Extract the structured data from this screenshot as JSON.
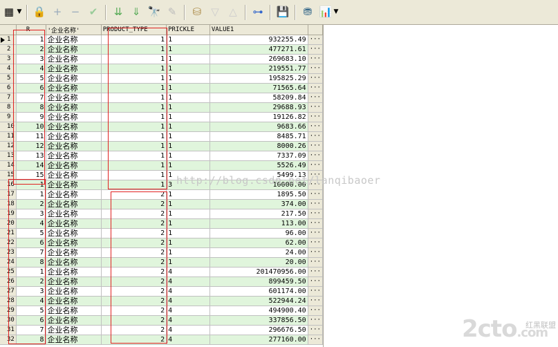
{
  "toolbar": {
    "icons": [
      "grid-icon",
      "lock-icon",
      "add-icon",
      "remove-icon",
      "post-icon",
      "filter-down-icon",
      "filter-down2-icon",
      "find-icon",
      "clear-icon",
      "query-icon",
      "sort-desc-icon",
      "sort-asc-icon",
      "tree-icon",
      "save-icon",
      "export-icon",
      "chart-icon"
    ]
  },
  "grid": {
    "columns": [
      "",
      "R",
      "'企业名称'",
      "PRODUCT_TYPE",
      "PRICKLE",
      "VALUE1",
      ""
    ],
    "ellipsis": "···",
    "rows": [
      {
        "n": "1",
        "r": "1",
        "name": "企业名称",
        "pt": "1",
        "pr": "1",
        "v": "932255.49"
      },
      {
        "n": "2",
        "r": "2",
        "name": "企业名称",
        "pt": "1",
        "pr": "1",
        "v": "477271.61"
      },
      {
        "n": "3",
        "r": "3",
        "name": "企业名称",
        "pt": "1",
        "pr": "1",
        "v": "269683.10"
      },
      {
        "n": "4",
        "r": "4",
        "name": "企业名称",
        "pt": "1",
        "pr": "1",
        "v": "219551.77"
      },
      {
        "n": "5",
        "r": "5",
        "name": "企业名称",
        "pt": "1",
        "pr": "1",
        "v": "195825.29"
      },
      {
        "n": "6",
        "r": "6",
        "name": "企业名称",
        "pt": "1",
        "pr": "1",
        "v": "71565.64"
      },
      {
        "n": "7",
        "r": "7",
        "name": "企业名称",
        "pt": "1",
        "pr": "1",
        "v": "58209.84"
      },
      {
        "n": "8",
        "r": "8",
        "name": "企业名称",
        "pt": "1",
        "pr": "1",
        "v": "29688.93"
      },
      {
        "n": "9",
        "r": "9",
        "name": "企业名称",
        "pt": "1",
        "pr": "1",
        "v": "19126.82"
      },
      {
        "n": "10",
        "r": "10",
        "name": "企业名称",
        "pt": "1",
        "pr": "1",
        "v": "9683.66"
      },
      {
        "n": "11",
        "r": "11",
        "name": "企业名称",
        "pt": "1",
        "pr": "1",
        "v": "8485.71"
      },
      {
        "n": "12",
        "r": "12",
        "name": "企业名称",
        "pt": "1",
        "pr": "1",
        "v": "8000.26"
      },
      {
        "n": "13",
        "r": "13",
        "name": "企业名称",
        "pt": "1",
        "pr": "1",
        "v": "7337.09"
      },
      {
        "n": "14",
        "r": "14",
        "name": "企业名称",
        "pt": "1",
        "pr": "1",
        "v": "5526.49"
      },
      {
        "n": "15",
        "r": "15",
        "name": "企业名称",
        "pt": "1",
        "pr": "1",
        "v": "5499.13"
      },
      {
        "n": "16",
        "r": "1",
        "name": "企业名称",
        "pt": "1",
        "pr": "3",
        "v": "10000.00"
      },
      {
        "n": "17",
        "r": "1",
        "name": "企业名称",
        "pt": "2",
        "pr": "1",
        "v": "1895.50"
      },
      {
        "n": "18",
        "r": "2",
        "name": "企业名称",
        "pt": "2",
        "pr": "1",
        "v": "374.00"
      },
      {
        "n": "19",
        "r": "3",
        "name": "企业名称",
        "pt": "2",
        "pr": "1",
        "v": "217.50"
      },
      {
        "n": "20",
        "r": "4",
        "name": "企业名称",
        "pt": "2",
        "pr": "1",
        "v": "113.00"
      },
      {
        "n": "21",
        "r": "5",
        "name": "企业名称",
        "pt": "2",
        "pr": "1",
        "v": "96.00"
      },
      {
        "n": "22",
        "r": "6",
        "name": "企业名称",
        "pt": "2",
        "pr": "1",
        "v": "62.00"
      },
      {
        "n": "23",
        "r": "7",
        "name": "企业名称",
        "pt": "2",
        "pr": "1",
        "v": "24.00"
      },
      {
        "n": "24",
        "r": "8",
        "name": "企业名称",
        "pt": "2",
        "pr": "1",
        "v": "20.00"
      },
      {
        "n": "25",
        "r": "1",
        "name": "企业名称",
        "pt": "2",
        "pr": "4",
        "v": "201470956.00"
      },
      {
        "n": "26",
        "r": "2",
        "name": "企业名称",
        "pt": "2",
        "pr": "4",
        "v": "899459.50"
      },
      {
        "n": "27",
        "r": "3",
        "name": "企业名称",
        "pt": "2",
        "pr": "4",
        "v": "601174.00"
      },
      {
        "n": "28",
        "r": "4",
        "name": "企业名称",
        "pt": "2",
        "pr": "4",
        "v": "522944.24"
      },
      {
        "n": "29",
        "r": "5",
        "name": "企业名称",
        "pt": "2",
        "pr": "4",
        "v": "494900.40"
      },
      {
        "n": "30",
        "r": "6",
        "name": "企业名称",
        "pt": "2",
        "pr": "4",
        "v": "337856.50"
      },
      {
        "n": "31",
        "r": "7",
        "name": "企业名称",
        "pt": "2",
        "pr": "4",
        "v": "296676.50"
      },
      {
        "n": "32",
        "r": "8",
        "name": "企业名称",
        "pt": "2",
        "pr": "4",
        "v": "277160.00"
      }
    ]
  },
  "watermark": "http://blog.csdn.net/lanqibaoer",
  "logo": {
    "main": "2cto",
    "suffix": ".com",
    "sub": "红黑联盟"
  },
  "colors": {
    "row_alt": "#e0f5dc",
    "highlight_box": "#e02020",
    "toolbar": "#ece9d8"
  }
}
